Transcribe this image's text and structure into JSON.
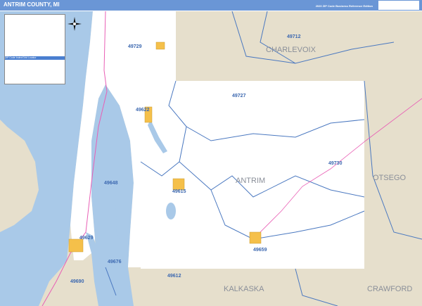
{
  "header": {
    "title": "ANTRIM COUNTY, MI",
    "edition": "2020 ZIP Code Business Reference Edition",
    "logo": "Market MAPS"
  },
  "legend": {
    "index_title": "ZIP Code Index/Grid Locator"
  },
  "map": {
    "colors": {
      "water": "#a9c9e8",
      "land": "#e6dfcc",
      "county": "#ffffff",
      "zip_boundary": "#4a78c0",
      "town": "#f5c04a",
      "highway": "#e95fb5"
    },
    "county_labels": [
      "CHARLEVOIX",
      "ANTRIM",
      "OTSEGO",
      "KALKASKA",
      "CRAWFORD"
    ],
    "zip_labels": [
      "49729",
      "49712",
      "49727",
      "49622",
      "49730",
      "49648",
      "49615",
      "49629",
      "49659",
      "49676",
      "49612",
      "49690"
    ]
  }
}
